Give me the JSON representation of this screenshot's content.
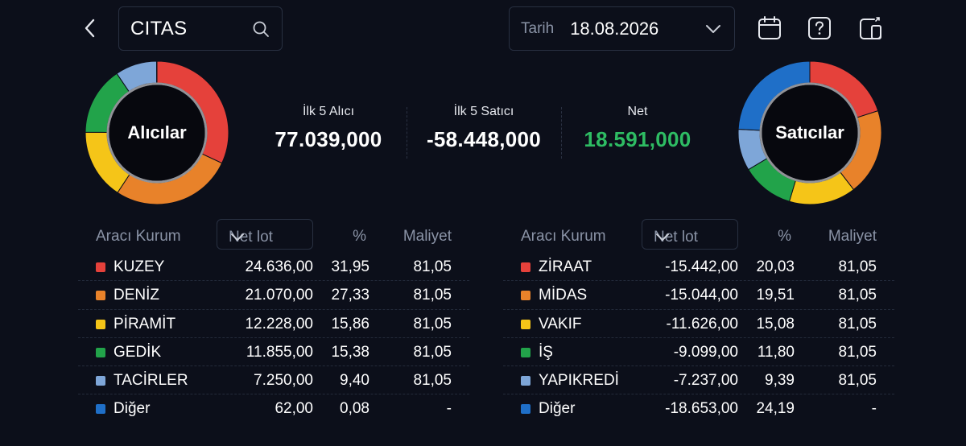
{
  "search": {
    "value": "CITAS"
  },
  "date": {
    "label": "Tarih",
    "value": "18.08.2026"
  },
  "icons": {
    "back": "chevron-left-icon",
    "search": "search-icon",
    "date_dropdown": "chevron-down-icon",
    "calendar": "calendar-icon",
    "help": "help-icon",
    "layout": "layout-toggle-icon"
  },
  "colors": {
    "red": "#e5413b",
    "orange": "#e8822a",
    "yellow": "#f5c518",
    "green": "#22a34a",
    "light_blue": "#7ea6d8",
    "blue": "#1f6fc8",
    "net_positive": "#2ebc63",
    "background": "#0c0f1a"
  },
  "buyers_donut": {
    "label": "Alıcılar",
    "segments": [
      {
        "name": "KUZEY",
        "percent": 31.95,
        "color": "#e5413b"
      },
      {
        "name": "DENİZ",
        "percent": 27.33,
        "color": "#e8822a"
      },
      {
        "name": "PİRAMİT",
        "percent": 15.86,
        "color": "#f5c518"
      },
      {
        "name": "GEDİK",
        "percent": 15.38,
        "color": "#22a34a"
      },
      {
        "name": "TACİRLER",
        "percent": 9.4,
        "color": "#7ea6d8"
      },
      {
        "name": "Diğer",
        "percent": 0.08,
        "color": "#1f6fc8"
      }
    ]
  },
  "sellers_donut": {
    "label": "Satıcılar",
    "segments": [
      {
        "name": "ZİRAAT",
        "percent": 20.03,
        "color": "#e5413b"
      },
      {
        "name": "MİDAS",
        "percent": 19.51,
        "color": "#e8822a"
      },
      {
        "name": "VAKIF",
        "percent": 15.08,
        "color": "#f5c518"
      },
      {
        "name": "İŞ",
        "percent": 11.8,
        "color": "#22a34a"
      },
      {
        "name": "YAPIKREDİ",
        "percent": 9.39,
        "color": "#7ea6d8"
      },
      {
        "name": "Diğer",
        "percent": 24.19,
        "color": "#1f6fc8"
      }
    ]
  },
  "summary": {
    "top5_buyers": {
      "label": "İlk 5 Alıcı",
      "value": "77.039,000"
    },
    "top5_sellers": {
      "label": "İlk 5 Satıcı",
      "value": "-58.448,000"
    },
    "net": {
      "label": "Net",
      "value": "18.591,000"
    }
  },
  "buyers_table": {
    "headers": {
      "broker": "Aracı Kurum",
      "net_lot": "Net lot",
      "percent": "%",
      "cost": "Maliyet"
    },
    "rows": [
      {
        "color": "#e5413b",
        "name": "KUZEY",
        "lot": "24.636,00",
        "pct": "31,95",
        "cost": "81,05"
      },
      {
        "color": "#e8822a",
        "name": "DENİZ",
        "lot": "21.070,00",
        "pct": "27,33",
        "cost": "81,05"
      },
      {
        "color": "#f5c518",
        "name": "PİRAMİT",
        "lot": "12.228,00",
        "pct": "15,86",
        "cost": "81,05"
      },
      {
        "color": "#22a34a",
        "name": "GEDİK",
        "lot": "11.855,00",
        "pct": "15,38",
        "cost": "81,05"
      },
      {
        "color": "#7ea6d8",
        "name": "TACİRLER",
        "lot": "7.250,00",
        "pct": "9,40",
        "cost": "81,05"
      },
      {
        "color": "#1f6fc8",
        "name": "Diğer",
        "lot": "62,00",
        "pct": "0,08",
        "cost": "-"
      }
    ]
  },
  "sellers_table": {
    "headers": {
      "broker": "Aracı Kurum",
      "net_lot": "Net lot",
      "percent": "%",
      "cost": "Maliyet"
    },
    "rows": [
      {
        "color": "#e5413b",
        "name": "ZİRAAT",
        "lot": "-15.442,00",
        "pct": "20,03",
        "cost": "81,05"
      },
      {
        "color": "#e8822a",
        "name": "MİDAS",
        "lot": "-15.044,00",
        "pct": "19,51",
        "cost": "81,05"
      },
      {
        "color": "#f5c518",
        "name": "VAKIF",
        "lot": "-11.626,00",
        "pct": "15,08",
        "cost": "81,05"
      },
      {
        "color": "#22a34a",
        "name": "İŞ",
        "lot": "-9.099,00",
        "pct": "11,80",
        "cost": "81,05"
      },
      {
        "color": "#7ea6d8",
        "name": "YAPIKREDİ",
        "lot": "-7.237,00",
        "pct": "9,39",
        "cost": "81,05"
      },
      {
        "color": "#1f6fc8",
        "name": "Diğer",
        "lot": "-18.653,00",
        "pct": "24,19",
        "cost": "-"
      }
    ]
  }
}
